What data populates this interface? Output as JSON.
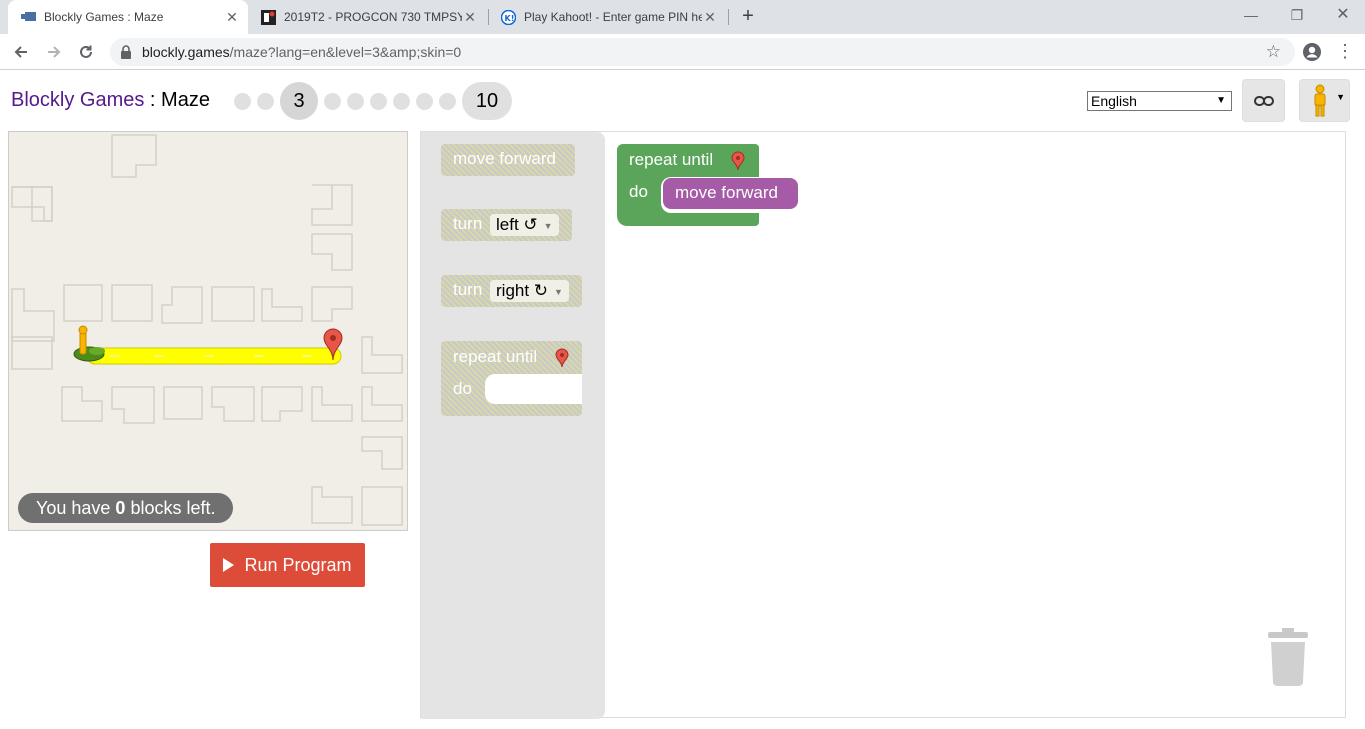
{
  "browser": {
    "tabs": [
      {
        "title": "Blockly Games : Maze",
        "active": true
      },
      {
        "title": "2019T2 - PROGCON 730 TMPSY",
        "active": false
      },
      {
        "title": "Play Kahoot! - Enter game PIN he",
        "active": false
      }
    ],
    "url_host": "blockly.games",
    "url_rest": "/maze?lang=en&level=3&amp;skin=0",
    "icons": {
      "back": "back-arrow-icon",
      "forward": "forward-arrow-icon",
      "reload": "reload-icon",
      "lock": "lock-icon",
      "star": "star-icon",
      "profile": "account-icon",
      "menu": "kebab-menu-icon"
    }
  },
  "header": {
    "brand": "Blockly Games",
    "separator": " : ",
    "game": "Maze",
    "current_level": "3",
    "last_level": "10",
    "language": "English"
  },
  "maze": {
    "blocks_prefix": "You have ",
    "blocks_count": "0",
    "blocks_suffix": " blocks left.",
    "run_label": "Run Program"
  },
  "toolbox": {
    "move_forward": "move forward",
    "turn": "turn",
    "left_option": "left ↺",
    "right_option": "right ↻",
    "repeat_until": "repeat until",
    "do": "do"
  },
  "program": {
    "repeat_until": "repeat until",
    "do": "do",
    "inner": "move forward"
  },
  "colors": {
    "brand": "#551a8b",
    "run_button": "#dd4b39",
    "loop_block": "#5ba55b",
    "move_block": "#a55ba5",
    "path": "#ffff00"
  }
}
